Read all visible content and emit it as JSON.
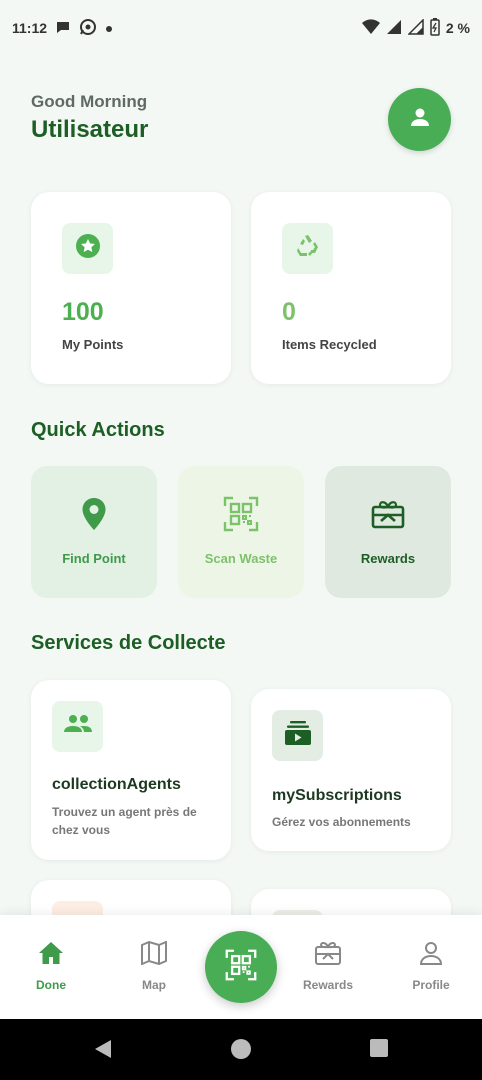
{
  "status_bar": {
    "time": "11:12",
    "battery_percent": "2 %",
    "icons": [
      "chat-bubble-icon",
      "whatsapp-icon",
      "dot-icon",
      "wifi-icon",
      "signal-icon",
      "signal-icon",
      "battery-icon"
    ]
  },
  "header": {
    "greeting": "Good Morning",
    "user_name": "Utilisateur",
    "avatar_icon": "person-icon"
  },
  "stats": [
    {
      "value": "100",
      "label": "My Points",
      "icon": "star-badge-icon"
    },
    {
      "value": "0",
      "label": "Items Recycled",
      "icon": "recycle-icon"
    }
  ],
  "quick_actions": {
    "title": "Quick Actions",
    "items": [
      {
        "label": "Find Point",
        "icon": "location-pin-icon"
      },
      {
        "label": "Scan Waste",
        "icon": "qr-scan-icon"
      },
      {
        "label": "Rewards",
        "icon": "gift-card-icon"
      }
    ]
  },
  "services": {
    "title": "Services de Collecte",
    "items": [
      {
        "title": "collectionAgents",
        "description": "Trouvez un agent près de chez vous",
        "icon": "group-icon"
      },
      {
        "title": "mySubscriptions",
        "description": "Gérez vos abonnements",
        "icon": "subscriptions-icon"
      }
    ]
  },
  "bottom_nav": {
    "items": [
      {
        "label": "Done",
        "icon": "home-icon",
        "active": true
      },
      {
        "label": "Map",
        "icon": "map-icon",
        "active": false
      },
      {
        "label": "Rewards",
        "icon": "gift-card-icon",
        "active": false
      },
      {
        "label": "Profile",
        "icon": "person-outline-icon",
        "active": false
      }
    ],
    "center_icon": "qr-scan-icon"
  },
  "colors": {
    "primary": "#48ad54",
    "dark_green": "#1d5e25",
    "background": "#f3f8f4"
  }
}
